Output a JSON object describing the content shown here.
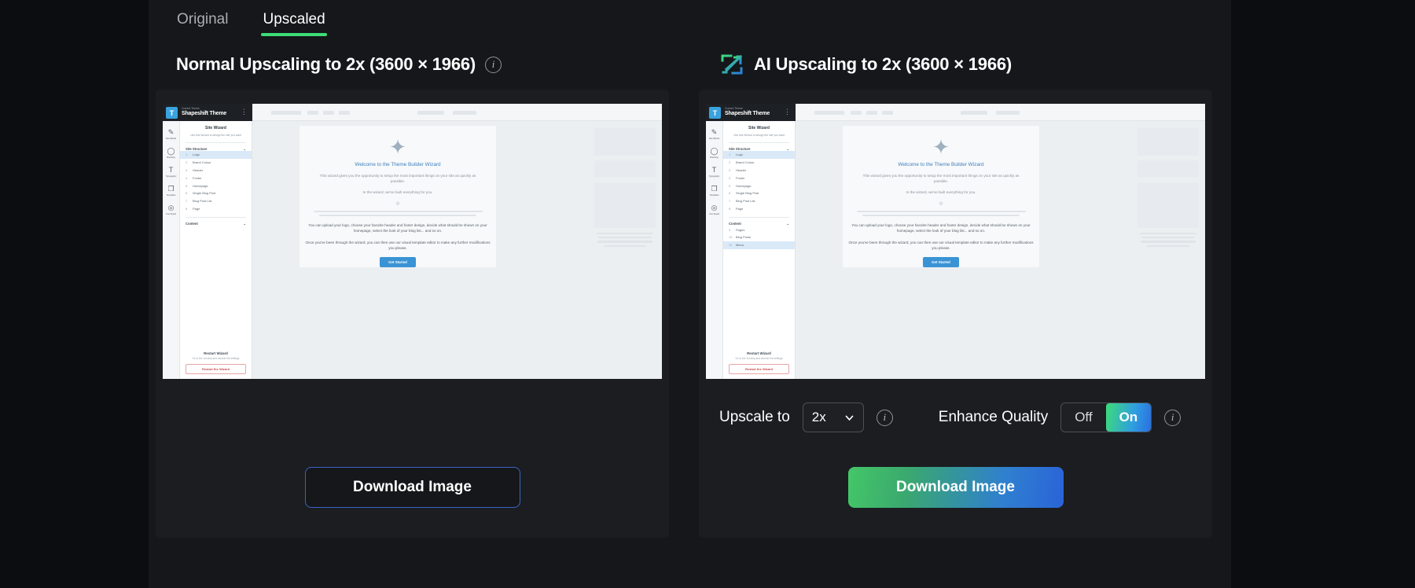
{
  "tabs": [
    {
      "label": "Original",
      "active": false
    },
    {
      "label": "Upscaled",
      "active": true
    }
  ],
  "panels": {
    "normal": {
      "title": "Normal Upscaling to 2x (3600 × 1966)",
      "info_icon": "info-icon",
      "download_label": "Download Image"
    },
    "ai": {
      "title": "AI Upscaling to 2x (3600 × 1966)",
      "badge_icon": "ai-upscale-icon",
      "download_label": "Download Image",
      "controls": {
        "upscale_label": "Upscale to",
        "upscale_value": "2x",
        "upscale_options": [
          "2x"
        ],
        "upscale_info_icon": "info-icon",
        "enhance_label": "Enhance Quality",
        "enhance_off_label": "Off",
        "enhance_on_label": "On",
        "enhance_value": "On",
        "enhance_info_icon": "info-icon"
      }
    }
  },
  "preview": {
    "topbar": {
      "eyebrow": "Current Theme",
      "brand": "Shapeshift Theme",
      "logo_glyph": "T",
      "kebab_icon": "kebab-menu-icon"
    },
    "rail": [
      {
        "icon": "wand-icon",
        "glyph": "✎",
        "label": "Site Wizard"
      },
      {
        "icon": "branding-icon",
        "glyph": "◯",
        "label": "Branding"
      },
      {
        "icon": "typography-icon",
        "glyph": "T",
        "label": "Typography"
      },
      {
        "icon": "templates-icon",
        "glyph": "❐",
        "label": "Templates"
      },
      {
        "icon": "line-speed-icon",
        "glyph": "◎",
        "label": "Line Speed"
      }
    ],
    "sidebar": {
      "title": "Site Wizard",
      "subtitle": "Use this Wizard to design the site you want",
      "section_structure": "Site Structure",
      "structure_items": [
        {
          "n": "1",
          "label": "Logo",
          "selected": true
        },
        {
          "n": "2",
          "label": "Brand Colour",
          "selected": false
        },
        {
          "n": "3",
          "label": "Header",
          "selected": false
        },
        {
          "n": "4",
          "label": "Footer",
          "selected": false
        },
        {
          "n": "5",
          "label": "Homepage",
          "selected": false
        },
        {
          "n": "6",
          "label": "Single Blog Post",
          "selected": false
        },
        {
          "n": "7",
          "label": "Blog Post List",
          "selected": false
        },
        {
          "n": "8",
          "label": "Page",
          "selected": false
        }
      ],
      "section_content": "Content",
      "content_items": [
        {
          "n": "9",
          "label": "Pages",
          "selected": false
        },
        {
          "n": "10",
          "label": "Blog Posts",
          "selected": false
        },
        {
          "n": "11",
          "label": "Menu",
          "selected": true
        }
      ],
      "restart_title": "Restart Wizard",
      "restart_sub": "Go to the 1st step and resume the settings",
      "restart_button": "Restart the Wizard"
    },
    "canvas": {
      "wand_icon": "magic-wand-icon",
      "heading": "Welcome to the Theme Builder Wizard",
      "para1": "This wizard gives you the opportunity to setup the most important things on your site as quickly as possible.",
      "para2": "In the wizard, we've built everything for you.",
      "para3": "You can upload your logo, choose your favorite header and footer design, decide what should be shown on your homepage, select the look of your blog list... and so on.",
      "para4": "Once you've been through the wizard, you can then use our visual template editor to make any further modifications you please.",
      "cta": "Get Started"
    }
  },
  "colors": {
    "page_bg": "#0b0d10",
    "stage_bg": "#15171a",
    "card_bg": "#1b1d21",
    "accent_green": "#3ddc78",
    "accent_blue": "#2a63d8",
    "outline_blue": "#3b64c4"
  }
}
